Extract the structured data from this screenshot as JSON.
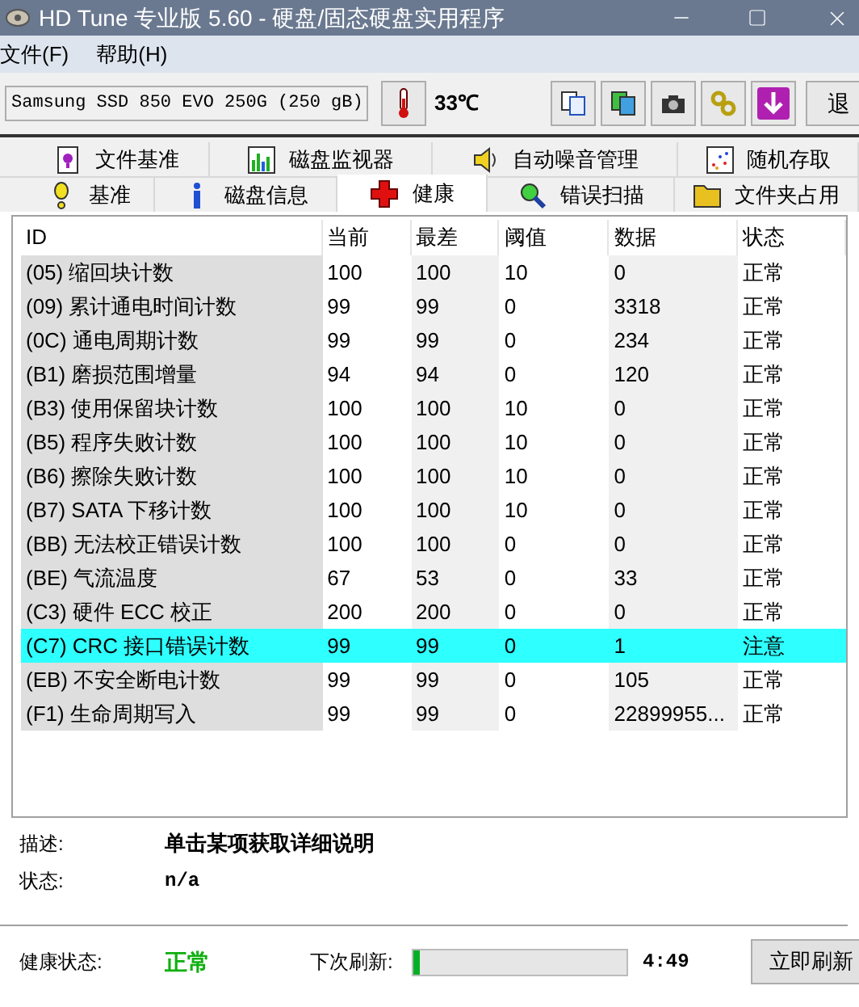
{
  "window": {
    "title": "HD Tune 专业版 5.60 - 硬盘/固态硬盘实用程序"
  },
  "menu": [
    "文件(F)",
    "帮助(H)"
  ],
  "toolbar": {
    "drive": "Samsung SSD 850 EVO 250G (250 gB)",
    "temperature": "33℃",
    "exit_button": "退"
  },
  "tabs_row_1": [
    {
      "label": "文件基准",
      "selected": false
    },
    {
      "label": "磁盘监视器",
      "selected": false
    },
    {
      "label": "自动噪音管理",
      "selected": false
    },
    {
      "label": "随机存取",
      "selected": false
    }
  ],
  "tabs_row_2": [
    {
      "label": "基准",
      "selected": false
    },
    {
      "label": "磁盘信息",
      "selected": false
    },
    {
      "label": "健康",
      "selected": true
    },
    {
      "label": "错误扫描",
      "selected": false
    },
    {
      "label": "文件夹占用",
      "selected": false
    }
  ],
  "table": {
    "columns": [
      "ID",
      "当前",
      "最差",
      "阈值",
      "数据",
      "状态"
    ],
    "rows": [
      {
        "cells": [
          "(05) 缩回块计数",
          "100",
          "100",
          "10",
          "0",
          "正常"
        ],
        "selected": false
      },
      {
        "cells": [
          "(09) 累计通电时间计数",
          "99",
          "99",
          "0",
          "3318",
          "正常"
        ],
        "selected": false
      },
      {
        "cells": [
          "(0C) 通电周期计数",
          "99",
          "99",
          "0",
          "234",
          "正常"
        ],
        "selected": false
      },
      {
        "cells": [
          "(B1) 磨损范围增量",
          "94",
          "94",
          "0",
          "120",
          "正常"
        ],
        "selected": false
      },
      {
        "cells": [
          "(B3) 使用保留块计数",
          "100",
          "100",
          "10",
          "0",
          "正常"
        ],
        "selected": false
      },
      {
        "cells": [
          "(B5) 程序失败计数",
          "100",
          "100",
          "10",
          "0",
          "正常"
        ],
        "selected": false
      },
      {
        "cells": [
          "(B6) 擦除失败计数",
          "100",
          "100",
          "10",
          "0",
          "正常"
        ],
        "selected": false
      },
      {
        "cells": [
          "(B7) SATA 下移计数",
          "100",
          "100",
          "10",
          "0",
          "正常"
        ],
        "selected": false
      },
      {
        "cells": [
          "(BB) 无法校正错误计数",
          "100",
          "100",
          "0",
          "0",
          "正常"
        ],
        "selected": false
      },
      {
        "cells": [
          "(BE) 气流温度",
          "67",
          "53",
          "0",
          "33",
          "正常"
        ],
        "selected": false
      },
      {
        "cells": [
          "(C3) 硬件 ECC 校正",
          "200",
          "200",
          "0",
          "0",
          "正常"
        ],
        "selected": false
      },
      {
        "cells": [
          "(C7) CRC 接口错误计数",
          "99",
          "99",
          "0",
          "1",
          "注意"
        ],
        "selected": true
      },
      {
        "cells": [
          "(EB) 不安全断电计数",
          "99",
          "99",
          "0",
          "105",
          "正常"
        ],
        "selected": false
      },
      {
        "cells": [
          "(F1) 生命周期写入",
          "99",
          "99",
          "0",
          "22899955...",
          "正常"
        ],
        "selected": false
      }
    ]
  },
  "details": {
    "description_label": "描述:",
    "description": "单击某项获取详细说明",
    "status_label": "状态:",
    "status": "n/a"
  },
  "footer": {
    "health_label": "健康状态:",
    "health": "正常",
    "refresh_label": "下次刷新:",
    "level": 0.03,
    "countdown": "4:49",
    "refresh_button": "立即刷新"
  }
}
